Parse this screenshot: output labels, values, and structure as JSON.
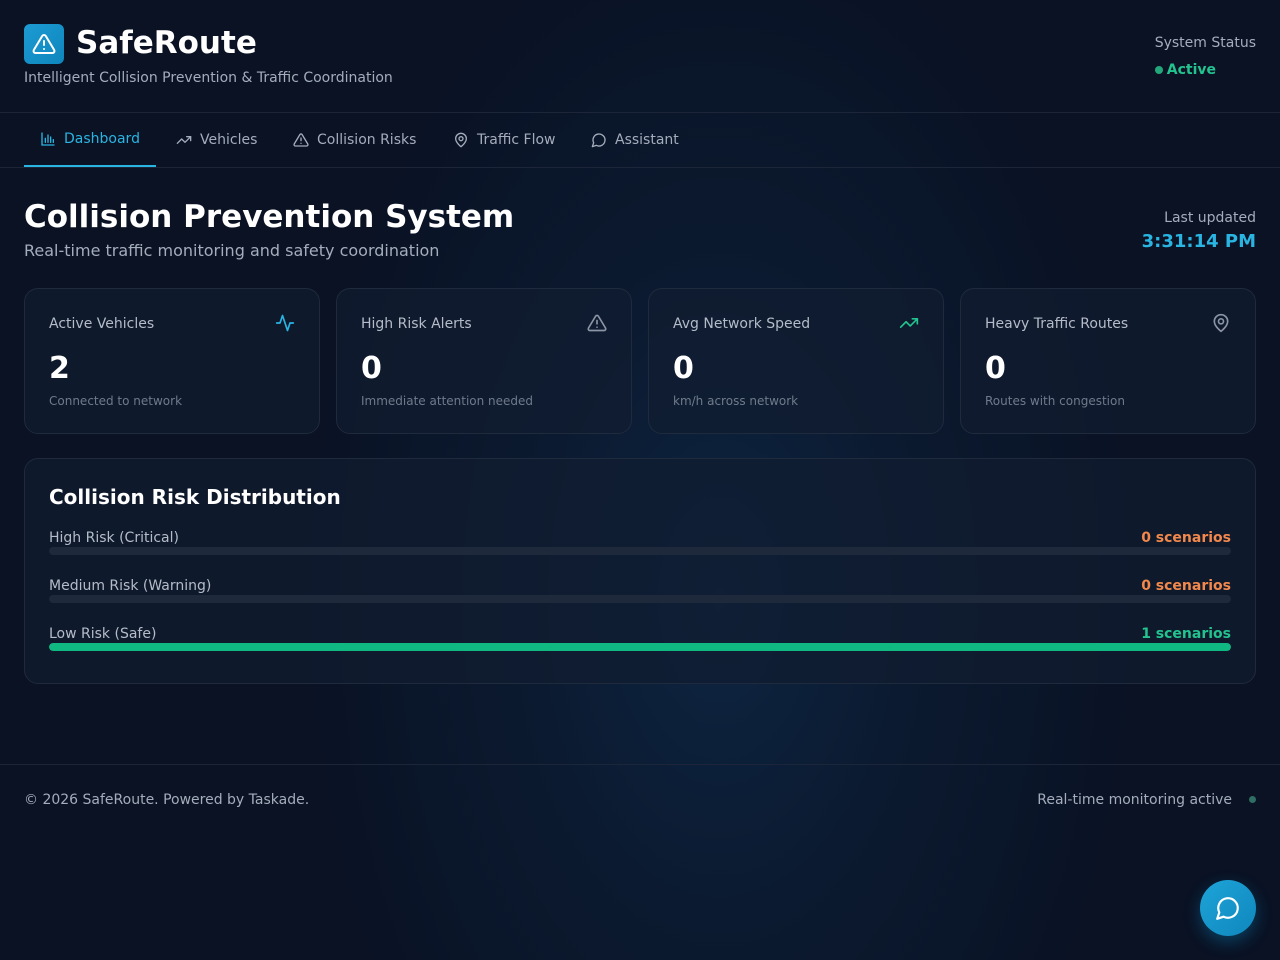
{
  "app": {
    "name": "SafeRoute",
    "tagline": "Intelligent Collision Prevention & Traffic Coordination",
    "logo_icon": "alert-triangle-icon"
  },
  "system_status": {
    "label": "System Status",
    "value": "Active",
    "color": "#22c38e"
  },
  "nav": {
    "tabs": [
      {
        "label": "Dashboard",
        "icon": "bar-chart-icon",
        "active": true
      },
      {
        "label": "Vehicles",
        "icon": "trending-up-icon",
        "active": false
      },
      {
        "label": "Collision Risks",
        "icon": "alert-triangle-icon",
        "active": false
      },
      {
        "label": "Traffic Flow",
        "icon": "map-pin-icon",
        "active": false
      },
      {
        "label": "Assistant",
        "icon": "message-circle-icon",
        "active": false
      }
    ]
  },
  "page": {
    "title": "Collision Prevention System",
    "subtitle": "Real-time traffic monitoring and safety coordination",
    "last_updated_label": "Last updated",
    "last_updated_value": "3:31:14 PM"
  },
  "stats": [
    {
      "label": "Active Vehicles",
      "value": "2",
      "sub": "Connected to network",
      "icon": "activity-icon",
      "icon_color": "#2ab4e2"
    },
    {
      "label": "High Risk Alerts",
      "value": "0",
      "sub": "Immediate attention needed",
      "icon": "alert-triangle-icon",
      "icon_color": "#8b95a5"
    },
    {
      "label": "Avg Network Speed",
      "value": "0",
      "sub": "km/h across network",
      "icon": "trending-up-icon",
      "icon_color": "#22c38e"
    },
    {
      "label": "Heavy Traffic Routes",
      "value": "0",
      "sub": "Routes with congestion",
      "icon": "map-pin-icon",
      "icon_color": "#8b95a5"
    }
  ],
  "risk_distribution": {
    "title": "Collision Risk Distribution",
    "rows": [
      {
        "label": "High Risk (Critical)",
        "count": "0 scenarios",
        "fraction": 0,
        "color": "#f2884b"
      },
      {
        "label": "Medium Risk (Warning)",
        "count": "0 scenarios",
        "fraction": 0,
        "color": "#f2884b"
      },
      {
        "label": "Low Risk (Safe)",
        "count": "1 scenarios",
        "fraction": 1,
        "color": "#22c38e"
      }
    ]
  },
  "footer": {
    "copyright": "© 2026 SafeRoute. Powered by Taskade.",
    "status": "Real-time monitoring active"
  },
  "chat_button": {
    "icon": "message-circle-icon"
  }
}
